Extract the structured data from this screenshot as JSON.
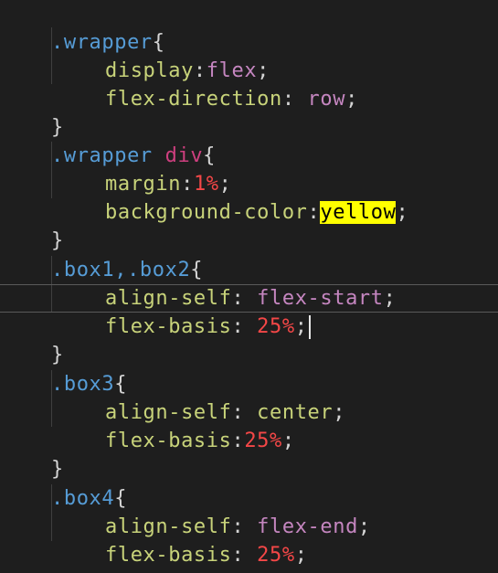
{
  "code": {
    "l1": {
      "sel": ".wrapper",
      "open": "{"
    },
    "l2": {
      "prop": "display",
      "colon": ":",
      "val": "flex",
      "end": ";"
    },
    "l3": {
      "prop": "flex-direction",
      "colon": ": ",
      "val": "row",
      "end": ";"
    },
    "l4": {
      "close": "}"
    },
    "l5": {
      "sel": ".wrapper",
      "space": " ",
      "tag": "div",
      "open": "{"
    },
    "l6": {
      "prop": "margin",
      "colon": ":",
      "val": "1%",
      "end": ";"
    },
    "l7": {
      "prop": "background-color",
      "colon": ":",
      "val": "yellow",
      "end": ";"
    },
    "l8": {
      "close": "}"
    },
    "l9": {
      "sel": ".box1,.box2",
      "open": "{"
    },
    "l10": {
      "prop": "align-self",
      "colon": ": ",
      "val": "flex-start",
      "end": ";"
    },
    "l11": {
      "prop": "flex-basis",
      "colon": ": ",
      "val": "25%",
      "end": ";"
    },
    "l12": {
      "close": "}"
    },
    "l13": {
      "sel": ".box3",
      "open": "{"
    },
    "l14": {
      "prop": "align-self",
      "colon": ": ",
      "val": "center",
      "end": ";"
    },
    "l15": {
      "prop": "flex-basis",
      "colon": ":",
      "val": "25%",
      "end": ";"
    },
    "l16": {
      "close": "}"
    },
    "l17": {
      "sel": ".box4",
      "open": "{"
    },
    "l18": {
      "prop": "align-self",
      "colon": ": ",
      "val": "flex-end",
      "end": ";"
    },
    "l19": {
      "prop": "flex-basis",
      "colon": ": ",
      "val": "25%",
      "end": ";"
    },
    "l20": {
      "close": "}"
    }
  },
  "colors": {
    "background": "#1e1e1e",
    "selector": "#569cd6",
    "tag": "#ce3f7f",
    "property": "#c8d37a",
    "keyword_value": "#c586c0",
    "number_value": "#f44747",
    "color_swatch_highlight": "#ffff00"
  }
}
